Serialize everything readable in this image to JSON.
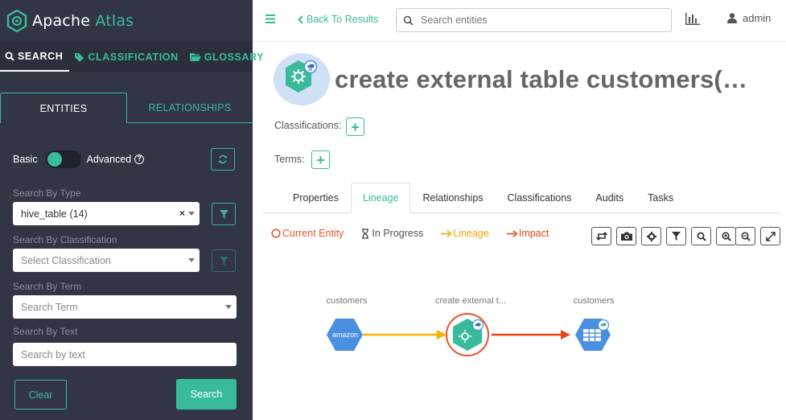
{
  "app": {
    "name_plain": "Apache",
    "name_accent": "Atlas"
  },
  "nav": [
    {
      "label": "SEARCH",
      "icon": "search-icon"
    },
    {
      "label": "CLASSIFICATION",
      "icon": "tag-icon"
    },
    {
      "label": "GLOSSARY",
      "icon": "folder-open-icon"
    }
  ],
  "search_tabs": [
    "ENTITIES",
    "RELATIONSHIPS"
  ],
  "mode": {
    "basic": "Basic",
    "advanced": "Advanced"
  },
  "filters": {
    "type_label": "Search By Type",
    "type_value": "hive_table (14)",
    "classification_label": "Search By Classification",
    "classification_placeholder": "Select Classification",
    "term_label": "Search By Term",
    "term_placeholder": "Search Term",
    "text_label": "Search By Text",
    "text_placeholder": "Search by text"
  },
  "buttons": {
    "clear": "Clear",
    "search": "Search"
  },
  "topbar": {
    "back": "Back To Results",
    "search_placeholder": "Search entities",
    "user": "admin"
  },
  "entity": {
    "title": "create external table customers(…",
    "classifications_label": "Classifications:",
    "terms_label": "Terms:"
  },
  "detail_tabs": [
    "Properties",
    "Lineage",
    "Relationships",
    "Classifications",
    "Audits",
    "Tasks"
  ],
  "lineage_legend": {
    "current": "Current Entity",
    "progress": "In Progress",
    "lineage": "Lineage",
    "impact": "Impact"
  },
  "graph_nodes": [
    {
      "label": "customers",
      "icon": "aws-s3-icon"
    },
    {
      "label": "create external t...",
      "icon": "process-gear-icon"
    },
    {
      "label": "customers",
      "icon": "hive-table-icon"
    }
  ],
  "colors": {
    "accent": "#38bb9b",
    "sidebar": "#323544",
    "current": "#e8552b",
    "lineage": "#f5b400",
    "impact": "#e8421a",
    "node": "#4a90e2",
    "process": "#38bb9b"
  }
}
